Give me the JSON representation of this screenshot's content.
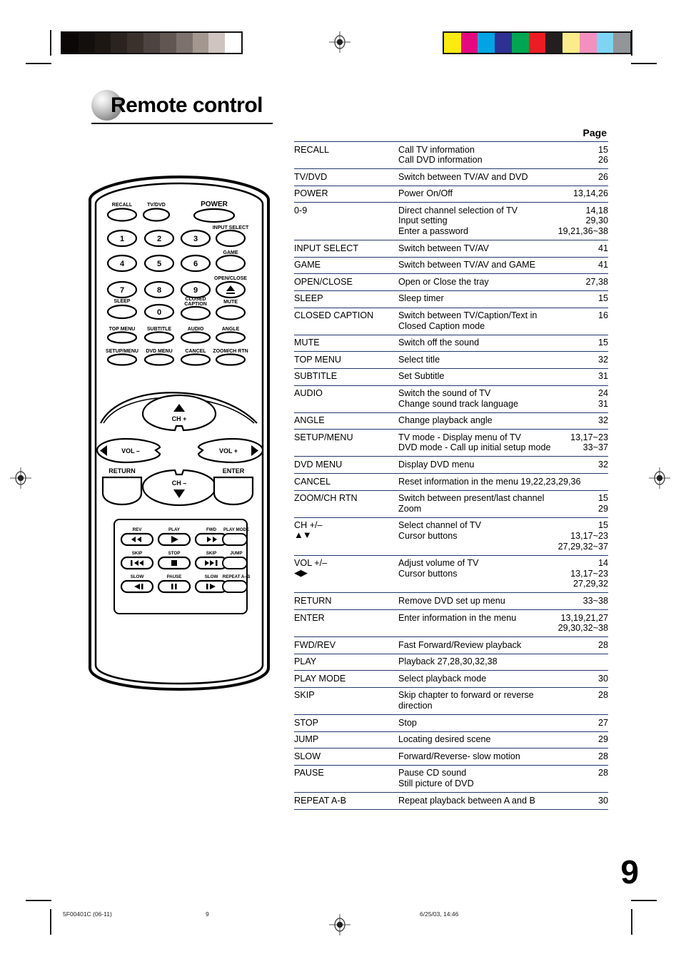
{
  "heading": {
    "title": "Remote control"
  },
  "table": {
    "page_header": "Page",
    "rows": [
      {
        "button": "RECALL",
        "desc": [
          "Call TV information",
          "Call DVD information"
        ],
        "pages": [
          "15",
          "26"
        ]
      },
      {
        "button": "TV/DVD",
        "desc": [
          "Switch between TV/AV and DVD"
        ],
        "pages": [
          "26"
        ]
      },
      {
        "button": "POWER",
        "desc": [
          "Power On/Off"
        ],
        "pages": [
          "13,14,26"
        ]
      },
      {
        "button": "0-9",
        "desc": [
          "Direct channel selection of TV",
          "Input setting",
          "Enter a password"
        ],
        "pages": [
          "14,18",
          "29,30",
          "19,21,36~38"
        ]
      },
      {
        "button": "INPUT SELECT",
        "desc": [
          "Switch between TV/AV"
        ],
        "pages": [
          "41"
        ]
      },
      {
        "button": "GAME",
        "desc": [
          "Switch between TV/AV and GAME"
        ],
        "pages": [
          "41"
        ]
      },
      {
        "button": "OPEN/CLOSE",
        "desc": [
          "Open or Close the tray"
        ],
        "pages": [
          "27,38"
        ]
      },
      {
        "button": "SLEEP",
        "desc": [
          "Sleep timer"
        ],
        "pages": [
          "15"
        ]
      },
      {
        "button": "CLOSED CAPTION",
        "desc": [
          "Switch between TV/Caption/Text in",
          "Closed Caption mode"
        ],
        "pages": [
          "16"
        ]
      },
      {
        "button": "MUTE",
        "desc": [
          "Switch off the sound"
        ],
        "pages": [
          "15"
        ]
      },
      {
        "button": "TOP MENU",
        "desc": [
          "Select title"
        ],
        "pages": [
          "32"
        ]
      },
      {
        "button": "SUBTITLE",
        "desc": [
          "Set Subtitle"
        ],
        "pages": [
          "31"
        ]
      },
      {
        "button": "AUDIO",
        "desc": [
          "Switch the sound of TV",
          "Change sound track language"
        ],
        "pages": [
          "24",
          "31"
        ]
      },
      {
        "button": "ANGLE",
        "desc": [
          "Change playback angle"
        ],
        "pages": [
          "32"
        ]
      },
      {
        "button": "SETUP/MENU",
        "desc": [
          "TV mode - Display menu of TV",
          "DVD mode - Call up initial setup mode"
        ],
        "pages": [
          "13,17~23",
          "33~37"
        ]
      },
      {
        "button": "DVD MENU",
        "desc": [
          "Display DVD menu"
        ],
        "pages": [
          "32"
        ]
      },
      {
        "button": "CANCEL",
        "desc": [
          "Reset information in the menu"
        ],
        "pages": [
          "19,22,23,29,36"
        ]
      },
      {
        "button": "ZOOM/CH RTN",
        "desc": [
          "Switch between present/last channel",
          "Zoom"
        ],
        "pages": [
          "15",
          "29"
        ]
      },
      {
        "button": "CH +/–",
        "button_sub": "▲▼",
        "desc": [
          "Select channel of TV",
          "Cursor buttons"
        ],
        "pages": [
          "15",
          "13,17~23",
          "27,29,32~37"
        ]
      },
      {
        "button": "VOL +/–",
        "button_sub": "◀▶",
        "desc": [
          "Adjust volume of TV",
          "Cursor buttons"
        ],
        "pages": [
          "14",
          "13,17~23",
          "27,29,32"
        ]
      },
      {
        "button": "RETURN",
        "desc": [
          "Remove DVD set up menu"
        ],
        "pages": [
          "33~38"
        ]
      },
      {
        "button": "ENTER",
        "desc": [
          "Enter information in the menu"
        ],
        "pages": [
          "13,19,21,27",
          "29,30,32~38"
        ]
      },
      {
        "button": "FWD/REV",
        "desc": [
          "Fast Forward/Review playback"
        ],
        "pages": [
          "28"
        ]
      },
      {
        "button": "PLAY",
        "desc": [
          "Playback"
        ],
        "pages": [
          "27,28,30,32,38"
        ]
      },
      {
        "button": "PLAY MODE",
        "desc": [
          "Select playback mode"
        ],
        "pages": [
          "30"
        ]
      },
      {
        "button": "SKIP",
        "desc": [
          "Skip chapter to forward or reverse",
          "direction"
        ],
        "pages": [
          "28"
        ]
      },
      {
        "button": "STOP",
        "desc": [
          "Stop"
        ],
        "pages": [
          "27"
        ]
      },
      {
        "button": "JUMP",
        "desc": [
          "Locating desired scene"
        ],
        "pages": [
          "29"
        ]
      },
      {
        "button": "SLOW",
        "desc": [
          "Forward/Reverse- slow motion"
        ],
        "pages": [
          "28"
        ]
      },
      {
        "button": "PAUSE",
        "desc": [
          "Pause CD sound",
          "Still picture of DVD"
        ],
        "pages": [
          "28"
        ]
      },
      {
        "button": "REPEAT A-B",
        "desc": [
          "Repeat playback between A and B"
        ],
        "pages": [
          "30"
        ]
      }
    ]
  },
  "remote": {
    "row_top": [
      "RECALL",
      "TV/DVD",
      "POWER"
    ],
    "right_col": [
      "INPUT SELECT",
      "GAME",
      "OPEN/CLOSE",
      "MUTE",
      "ANGLE",
      "ZOOM/CH RTN"
    ],
    "numbers": [
      "1",
      "2",
      "3",
      "4",
      "5",
      "6",
      "7",
      "8",
      "9",
      "0"
    ],
    "sleep": "SLEEP",
    "closed_caption_l1": "CLOSED",
    "closed_caption_l2": "CAPTION",
    "menu_row1": [
      "TOP MENU",
      "SUBTITLE",
      "AUDIO"
    ],
    "menu_row2": [
      "SETUP/MENU",
      "DVD MENU",
      "CANCEL"
    ],
    "nav": {
      "ch_up": "CH +",
      "ch_down": "CH –",
      "vol_down": "VOL –",
      "vol_up": "VOL +",
      "return": "RETURN",
      "enter": "ENTER"
    },
    "transport": [
      [
        "REV",
        "PLAY",
        "FWD",
        "PLAY MODE"
      ],
      [
        "SKIP",
        "STOP",
        "SKIP",
        "JUMP"
      ],
      [
        "SLOW",
        "PAUSE",
        "SLOW",
        "REPEAT A–B"
      ]
    ]
  },
  "folio": "9",
  "footer": {
    "doc_code": "5F00401C (06-11)",
    "page_num": "9",
    "timestamp": "6/25/03, 14:46"
  },
  "calibration": {
    "gray_swatches": [
      "#0a0706",
      "#130f0d",
      "#1d1714",
      "#2a2320",
      "#3a302c",
      "#4d4340",
      "#625653",
      "#7d716e",
      "#a3978f",
      "#cfc4bf",
      "#ffffff"
    ],
    "color_swatches": [
      "#fcea10",
      "#e5097f",
      "#00a4e4",
      "#2e3192",
      "#00a651",
      "#ed1c24",
      "#231f20",
      "#fbeb8c",
      "#f490c0",
      "#7fd4f4",
      "#939598"
    ]
  }
}
